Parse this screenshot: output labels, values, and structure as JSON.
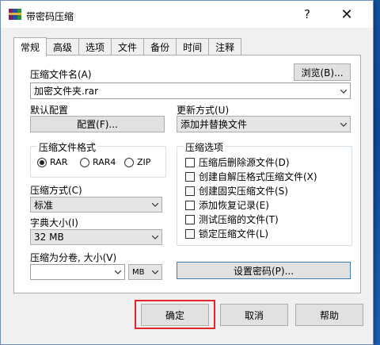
{
  "window": {
    "title": "带密码压缩",
    "help_label": "?",
    "close_label": "✕"
  },
  "tabs": [
    {
      "label": "常规",
      "active": true
    },
    {
      "label": "高级"
    },
    {
      "label": "选项"
    },
    {
      "label": "文件"
    },
    {
      "label": "备份"
    },
    {
      "label": "时间"
    },
    {
      "label": "注释"
    }
  ],
  "general": {
    "archive_name_label": "压缩文件名(A)",
    "browse_label": "浏览(B)...",
    "archive_name_value": "加密文件夹.rar",
    "default_profile_label": "默认配置",
    "profile_button_label": "配置(F)...",
    "update_mode_label": "更新方式(U)",
    "update_mode_value": "添加并替换文件",
    "format_group_title": "压缩文件格式",
    "formats": [
      "RAR",
      "RAR4",
      "ZIP"
    ],
    "method_label": "压缩方式(C)",
    "method_value": "标准",
    "dict_label": "字典大小(I)",
    "dict_value": "32 MB",
    "split_label": "压缩为分卷, 大小(V)",
    "split_value": "",
    "split_unit": "MB",
    "options_group_title": "压缩选项",
    "options": [
      "压缩后删除源文件(D)",
      "创建自解压格式压缩文件(X)",
      "创建固实压缩文件(S)",
      "添加恢复记录(E)",
      "测试压缩的文件(T)",
      "锁定压缩文件(L)"
    ],
    "set_password_label": "设置密码(P)..."
  },
  "footer": {
    "ok_label": "确定",
    "cancel_label": "取消",
    "help_label": "帮助"
  }
}
